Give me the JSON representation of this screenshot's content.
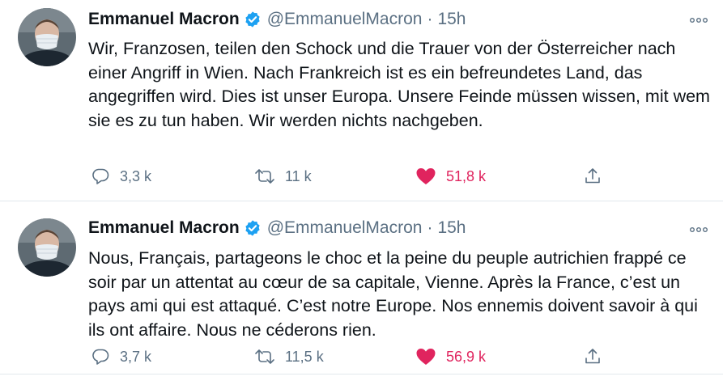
{
  "tweets": [
    {
      "author_name": "Emmanuel Macron",
      "handle": "@EmmanuelMacron",
      "separator": "·",
      "time": "15h",
      "text": "Wir, Franzosen, teilen den Schock und die Trauer von der Österreicher nach einer Angriff in Wien. Nach Frankreich ist es ein befreundetes Land, das angegriffen wird. Dies ist unser Europa. Unsere Feinde müssen wissen, mit wem sie es zu tun haben. Wir werden nichts nachgeben.",
      "replies": "3,3 k",
      "retweets": "11 k",
      "likes": "51,8 k"
    },
    {
      "author_name": "Emmanuel Macron",
      "handle": "@EmmanuelMacron",
      "separator": "·",
      "time": "15h",
      "text": "Nous, Français, partageons le choc et la peine du peuple autrichien frappé ce soir par un attentat au cœur de sa capitale, Vienne. Après la France, c’est un pays ami qui est attaqué. C’est notre Europe. Nos ennemis doivent savoir à qui ils ont affaire. Nous ne céderons rien.",
      "replies": "3,7 k",
      "retweets": "11,5 k",
      "likes": "56,9 k"
    }
  ],
  "colors": {
    "like_active": "#e0245e",
    "verified_badge": "#1da1f2",
    "secondary_text": "#5b7083"
  },
  "icons": [
    "verified-badge-icon",
    "more-icon",
    "reply-icon",
    "retweet-icon",
    "heart-icon",
    "share-icon"
  ]
}
